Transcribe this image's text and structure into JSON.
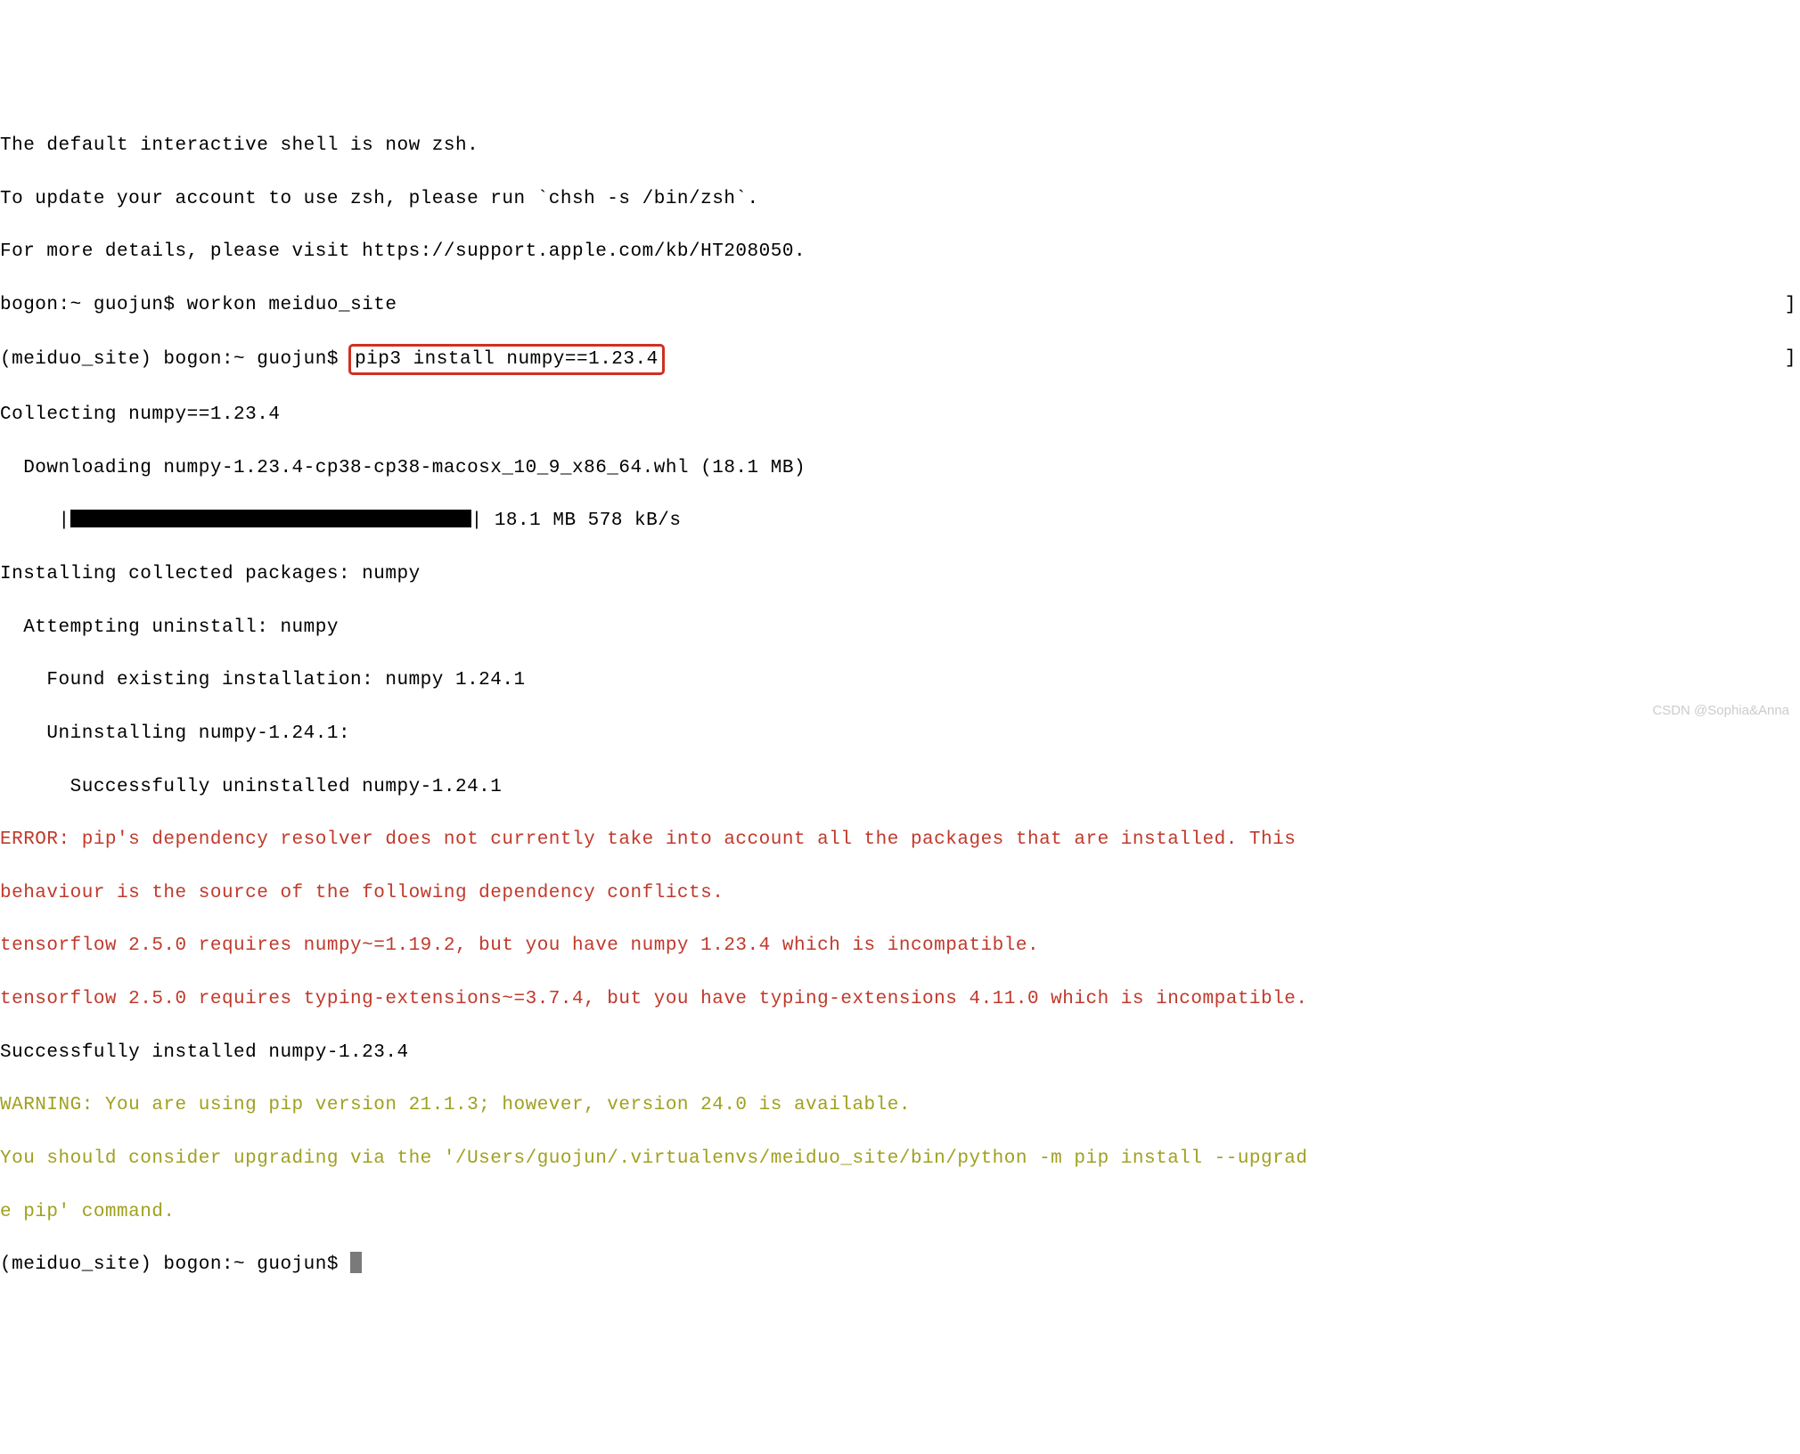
{
  "shell_notice": {
    "line1": "The default interactive shell is now zsh.",
    "line2": "To update your account to use zsh, please run `chsh -s /bin/zsh`.",
    "line3": "For more details, please visit https://support.apple.com/kb/HT208050."
  },
  "prompts": {
    "first": "bogon:~ guojun$ ",
    "workon_cmd": "workon meiduo_site",
    "venv": "(meiduo_site) bogon:~ guojun$ ",
    "pip_cmd": "pip3 install numpy==1.23.4"
  },
  "pip_output": {
    "collecting": "Collecting numpy==1.23.4",
    "downloading": "  Downloading numpy-1.23.4-cp38-cp38-macosx_10_9_x86_64.whl (18.1 MB)",
    "progress_prefix": "     |",
    "progress_suffix": "| 18.1 MB 578 kB/s",
    "installing": "Installing collected packages: numpy",
    "attempting": "  Attempting uninstall: numpy",
    "found": "    Found existing installation: numpy 1.24.1",
    "uninstalling": "    Uninstalling numpy-1.24.1:",
    "success_uninstall": "      Successfully uninstalled numpy-1.24.1"
  },
  "error_lines": {
    "line1": "ERROR: pip's dependency resolver does not currently take into account all the packages that are installed. This ",
    "line2": "behaviour is the source of the following dependency conflicts.",
    "line3": "tensorflow 2.5.0 requires numpy~=1.19.2, but you have numpy 1.23.4 which is incompatible.",
    "line4": "tensorflow 2.5.0 requires typing-extensions~=3.7.4, but you have typing-extensions 4.11.0 which is incompatible."
  },
  "success": "Successfully installed numpy-1.23.4",
  "warning_lines": {
    "line1": "WARNING: You are using pip version 21.1.3; however, version 24.0 is available.",
    "line2": "You should consider upgrading via the '/Users/guojun/.virtualenvs/meiduo_site/bin/python -m pip install --upgrad",
    "line3": "e pip' command."
  },
  "final_prompt": "(meiduo_site) bogon:~ guojun$ ",
  "watermark": "CSDN @Sophia&Anna",
  "bracket_right1": "]",
  "bracket_right2": "]"
}
